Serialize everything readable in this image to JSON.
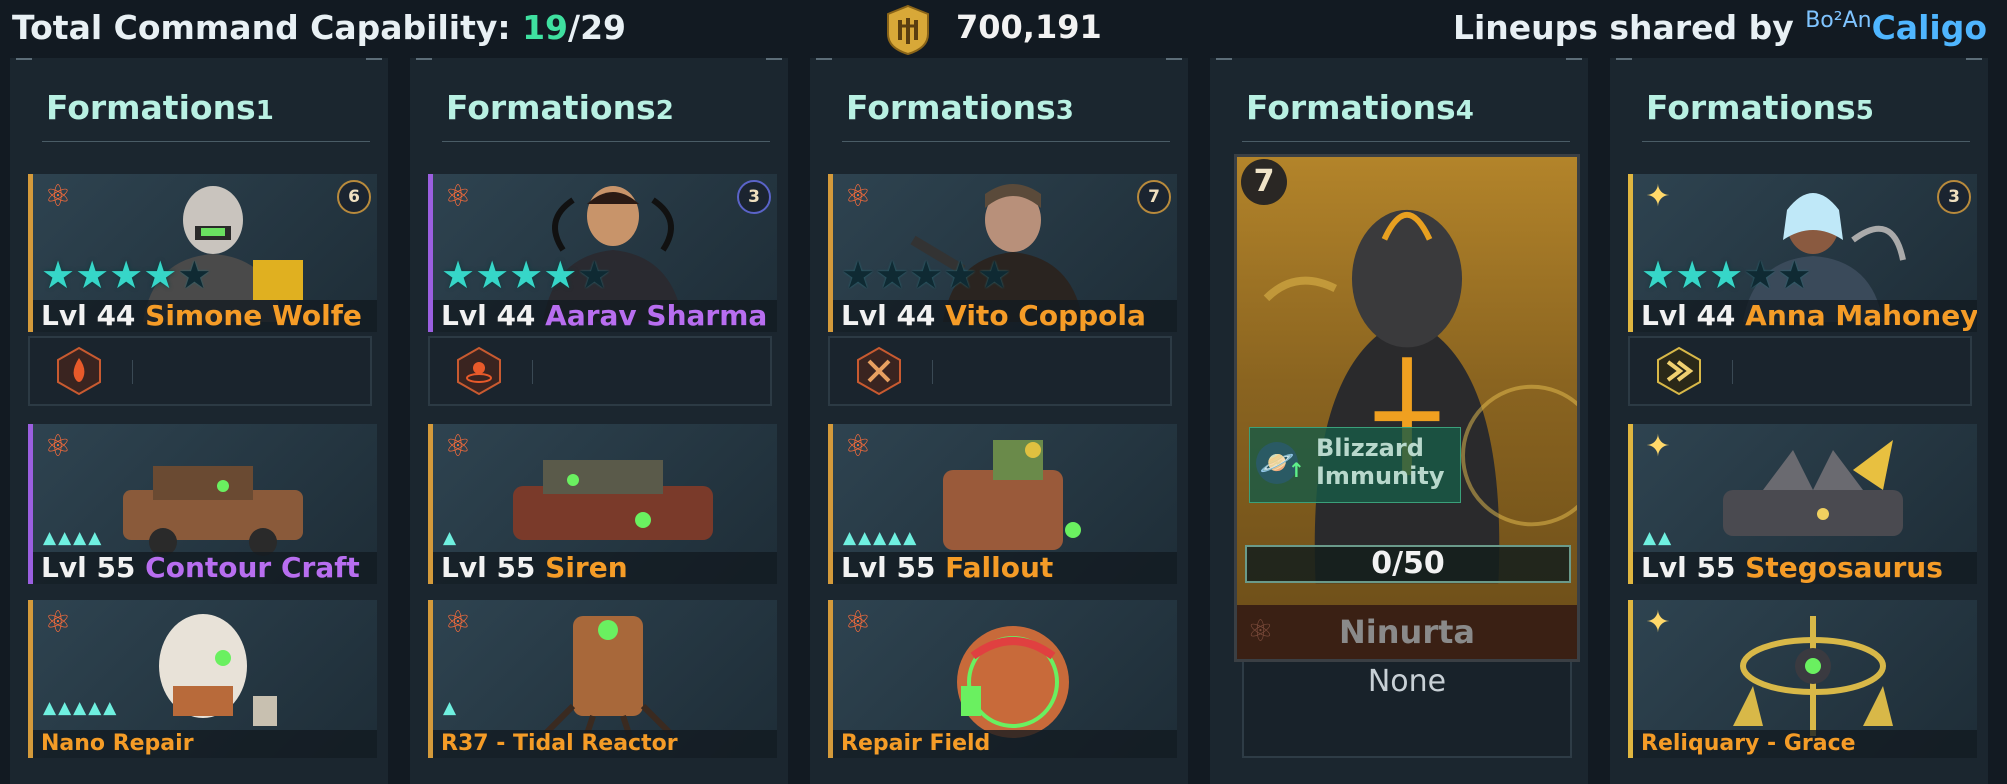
{
  "header": {
    "tcc_label": "Total Command Capability: ",
    "tcc_current": "19",
    "tcc_total": "/29",
    "currency_icon": "gold-crest-icon",
    "currency_value": "700,191",
    "shared_label": "Lineups shared by ",
    "shared_tag": "Bo²An",
    "shared_name": "Caligo"
  },
  "colors": {
    "accent_teal": "#b9f1e3",
    "name_orange": "#f59c27",
    "name_purple": "#b86ef0",
    "tcc_green": "#3fe0a0",
    "shared_blue": "#4fb6ff"
  },
  "formations": [
    {
      "title": "Formations",
      "num": "1",
      "hero": {
        "level": "Lvl 44",
        "name": "Simone Wolfe",
        "rank": "6",
        "stars": 4,
        "faction_icon": "atom-icon"
      },
      "skill_icon": "flame-skill-icon",
      "vehicle": {
        "level": "Lvl 55",
        "name": "Contour Craft",
        "tier": 4
      },
      "drone": {
        "name": "Nano Repair",
        "tier": 5
      }
    },
    {
      "title": "Formations",
      "num": "2",
      "hero": {
        "level": "Lvl 44",
        "name": "Aarav Sharma",
        "rank": "3",
        "stars": 4,
        "faction_icon": "atom-icon"
      },
      "skill_icon": "pulse-skill-icon",
      "vehicle": {
        "level": "Lvl 55",
        "name": "Siren",
        "tier": 1
      },
      "drone": {
        "name": "R37 - Tidal Reactor",
        "tier": 1
      }
    },
    {
      "title": "Formations",
      "num": "3",
      "hero": {
        "level": "Lvl 44",
        "name": "Vito Coppola",
        "rank": "7",
        "stars": 0,
        "faction_icon": "atom-icon"
      },
      "skill_icon": "wrench-skill-icon",
      "vehicle": {
        "level": "Lvl 55",
        "name": "Fallout",
        "tier": 5
      },
      "drone": {
        "name": "Repair Field",
        "tier": 0
      }
    },
    {
      "title": "Formations",
      "num": "4",
      "big": {
        "rank": "7",
        "buff": "Blizzard\nImmunity",
        "buff_line1": "Blizzard",
        "buff_line2": "Immunity",
        "progress": "0/50",
        "name": "Ninurta",
        "slot": "None"
      }
    },
    {
      "title": "Formations",
      "num": "5",
      "hero": {
        "level": "Lvl 44",
        "name": "Anna Mahoney",
        "rank": "3",
        "stars": 3,
        "faction_icon": "sparkle-icon"
      },
      "skill_icon": "chevron-skill-icon",
      "vehicle": {
        "level": "Lvl 55",
        "name": "Stegosaurus",
        "tier": 2
      },
      "drone": {
        "name": "Reliquary - Grace",
        "tier": 0
      }
    }
  ]
}
